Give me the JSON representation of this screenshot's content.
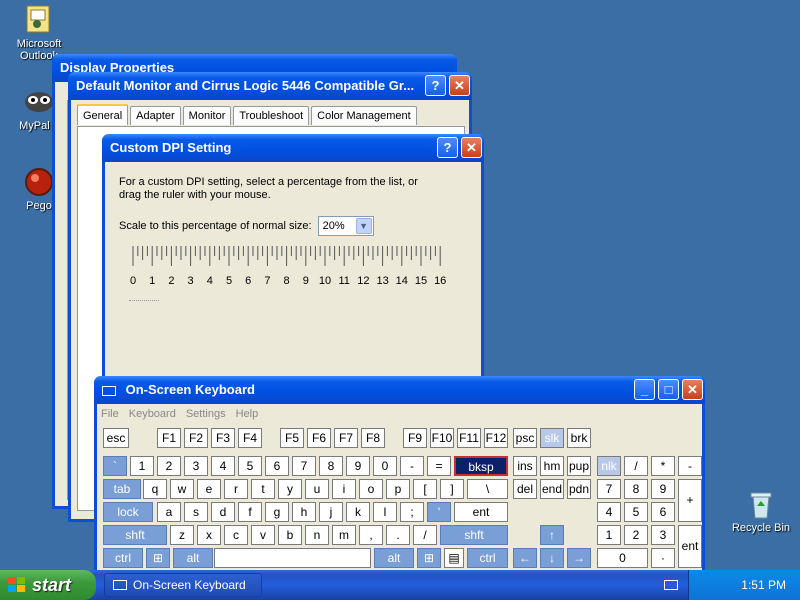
{
  "desktop": {
    "icons": [
      {
        "label": "Microsoft Outlook",
        "label_visible": "Microsoft\nOutlook",
        "icon": "outlook-icon"
      },
      {
        "label": "MyPal 6",
        "label_visible": "MyPal 6",
        "icon": "mypal-icon"
      },
      {
        "label": "Pego",
        "label_visible": "Pego",
        "icon": "pego-icon"
      },
      {
        "label": "Recycle Bin",
        "label_visible": "Recycle Bin",
        "icon": "recycle-bin-icon"
      }
    ]
  },
  "display_props": {
    "title": "Display Properties",
    "help": "?",
    "close": "✕"
  },
  "monitor_props": {
    "title": "Default Monitor and Cirrus Logic 5446 Compatible Gr...",
    "help": "?",
    "close": "✕",
    "tabs": [
      "General",
      "Adapter",
      "Monitor",
      "Troubleshoot",
      "Color Management"
    ],
    "active_tab": "General"
  },
  "dpi_dialog": {
    "title": "Custom DPI Setting",
    "help": "?",
    "close": "✕",
    "instructions": "For a custom DPI setting, select a percentage from the list, or drag the ruler with your mouse.",
    "scale_label": "Scale to this percentage of normal size:",
    "scale_value": "20%",
    "ruler_labels": [
      "0",
      "1",
      "2",
      "3",
      "4",
      "5",
      "6",
      "7",
      "8",
      "9",
      "10",
      "11",
      "12",
      "13",
      "14",
      "15",
      "16"
    ]
  },
  "keyboard": {
    "title": "On-Screen Keyboard",
    "menu": [
      "File",
      "Keyboard",
      "Settings",
      "Help"
    ],
    "colors": {
      "mod": "#7a9ed6",
      "active": "#0b2169"
    },
    "active_key": "bksp"
  },
  "taskbar": {
    "start_label": "start",
    "task_label": "On-Screen Keyboard",
    "clock": "1:51 PM"
  }
}
